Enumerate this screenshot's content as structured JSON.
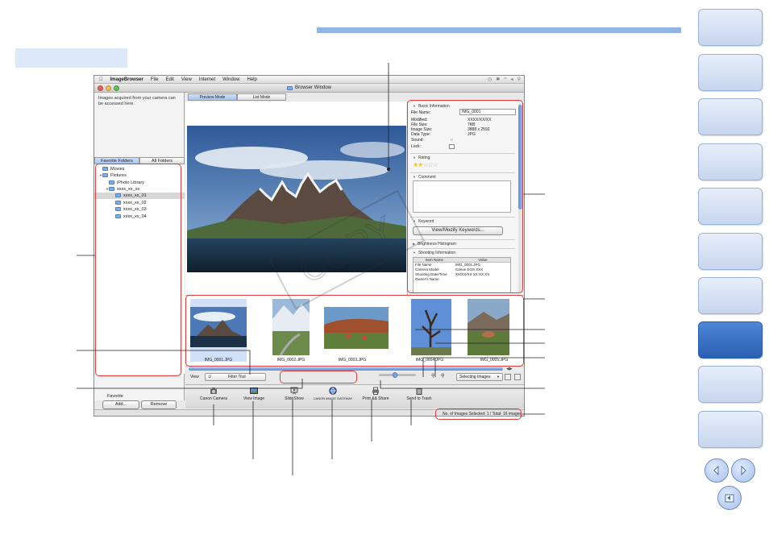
{
  "app": {
    "menu": [
      "ImageBrowser",
      "File",
      "Edit",
      "View",
      "Internet",
      "Window",
      "Help"
    ],
    "window_title": "Browser Window"
  },
  "left_pane": {
    "info_text": "Images acquired from your camera can be accessed here.",
    "tabs": [
      "Favorite Folders",
      "All Folders"
    ],
    "tree": [
      "Movies",
      "Pictures",
      "iPhoto Library",
      "xxxx_xx_xx",
      "xxxx_xx_01",
      "xxxx_xx_02",
      "xxxx_xx_03",
      "xxxx_xx_04"
    ],
    "favorite_label": "Favorite",
    "add_button": "Add...",
    "remove_button": "Remove"
  },
  "view_tabs": [
    "Preview Mode",
    "List Mode"
  ],
  "info_panel": {
    "basic_title": "Basic Information",
    "fields": [
      {
        "label": "File Name:",
        "value": "IMG_0001"
      },
      {
        "label": "Modified:",
        "value": "XXXX/XX/XX"
      },
      {
        "label": "File Size:",
        "value": "7KB"
      },
      {
        "label": "Image Size:",
        "value": "3888 x 2592"
      },
      {
        "label": "Data Type:",
        "value": "JPG"
      },
      {
        "label": "Sound:",
        "value": ""
      },
      {
        "label": "Lock:",
        "value": ""
      }
    ],
    "rating_title": "Rating",
    "rating_stars": 2,
    "comment_title": "Comment",
    "keyword_title": "Keyword",
    "keyword_button": "View/Modify Keywords...",
    "histogram_title": "Brightness Histogram",
    "shooting_title": "Shooting Information",
    "shooting_headers": [
      "Item Name",
      "Value"
    ],
    "shooting_rows": [
      [
        "File Name",
        "IMG_0001.JPG"
      ],
      [
        "Camera Model",
        "Canon EOS XXX"
      ],
      [
        "Shooting Date/Time",
        "XX/XX/XX XX:XX:XX"
      ],
      [
        "Owner's Name",
        ""
      ]
    ]
  },
  "thumbnails": [
    "IMG_0001.JPG",
    "IMG_0002.JPG",
    "IMG_0003.JPG",
    "IMG_0004.JPG",
    "IMG_0005.JPG"
  ],
  "filter_bar": {
    "view_label": "View",
    "filter_tool": "Filter Tool",
    "selecting_images": "Selecting Images"
  },
  "toolbar": {
    "canon_camera": "Canon Camera",
    "view_image": "View Image",
    "slideshow": "SlideShow",
    "gateway": "CANON iMAGE GATEWAY",
    "print_share": "Print && Share",
    "trash": "Send to Trash"
  },
  "status": "No. of Images Selected: 1 / Total: 16 images",
  "watermark": "COPY",
  "colors": {
    "callout": "#e23b3b",
    "accent": "#5f8fd6",
    "nav_active": "#2b5fb1"
  }
}
